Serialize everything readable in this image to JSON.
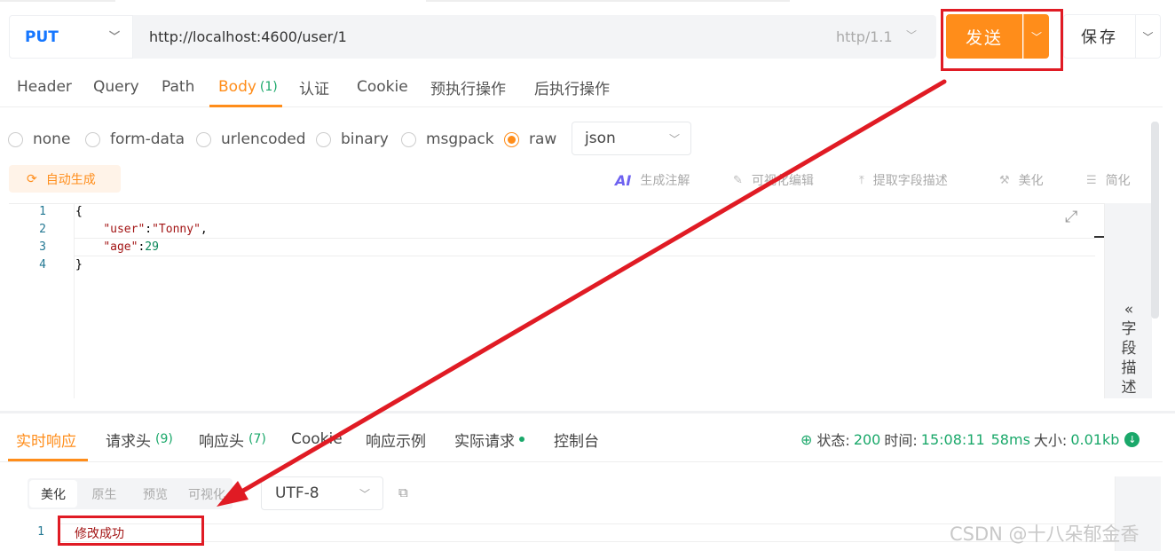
{
  "request": {
    "method": "PUT",
    "url": "http://localhost:4600/user/1",
    "http_version": "http/1.1",
    "send_label": "发送",
    "save_label": "保存"
  },
  "request_tabs": [
    {
      "label": "Header"
    },
    {
      "label": "Query"
    },
    {
      "label": "Path"
    },
    {
      "label": "Body",
      "count": "(1)"
    },
    {
      "label": "认证"
    },
    {
      "label": "Cookie"
    },
    {
      "label": "预执行操作"
    },
    {
      "label": "后执行操作"
    }
  ],
  "body_types": [
    "none",
    "form-data",
    "urlencoded",
    "binary",
    "msgpack",
    "raw"
  ],
  "body_type_selected": "raw",
  "raw_format": "json",
  "tools": {
    "auto_generate": "自动生成",
    "ai_badge": "AI",
    "gen_comment": "生成注解",
    "visual_edit": "可视化编辑",
    "extract_desc": "提取字段描述",
    "beautify": "美化",
    "simplify": "简化"
  },
  "editor": {
    "line_numbers": [
      "1",
      "2",
      "3",
      "4"
    ],
    "lines": [
      "{",
      "    \"user\":\"Tonny\",",
      "    \"age\":29",
      "}"
    ],
    "tokens": {
      "open": "{",
      "user_key": "\"user\"",
      "colon": ":",
      "user_val": "\"Tonny\"",
      "comma": ",",
      "age_key": "\"age\"",
      "age_val": "29",
      "close": "}"
    }
  },
  "side_panel": {
    "chevron": "«",
    "label": [
      "字",
      "段",
      "描",
      "述"
    ]
  },
  "response_tabs": [
    {
      "label": "实时响应"
    },
    {
      "label": "请求头",
      "count": "(9)"
    },
    {
      "label": "响应头",
      "count": "(7)"
    },
    {
      "label": "Cookie"
    },
    {
      "label": "响应示例"
    },
    {
      "label": "实际请求"
    },
    {
      "label": "控制台"
    }
  ],
  "status": {
    "status_label": "状态:",
    "status_value": "200",
    "time_label": "时间:",
    "time_value": "15:08:11",
    "duration": "58ms",
    "size_label": "大小:",
    "size_value": "0.01kb"
  },
  "response_view_modes": [
    "美化",
    "原生",
    "预览",
    "可视化"
  ],
  "response_encoding": "UTF-8",
  "response_body": {
    "line_number": "1",
    "text": "修改成功"
  },
  "watermark": "CSDN @十八朵郁金香",
  "colors": {
    "accent": "#ff8d1a",
    "success": "#1aa86a",
    "method": "#1677ff",
    "annotation": "#e01b24"
  }
}
